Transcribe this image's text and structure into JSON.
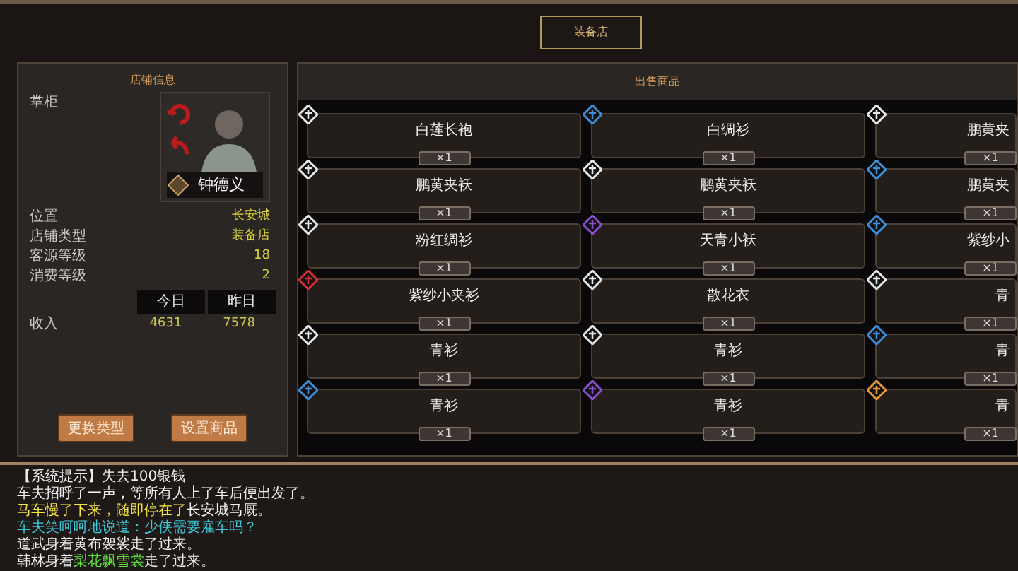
{
  "window": {
    "title": "装备店"
  },
  "shop_info": {
    "title": "店铺信息",
    "keeper_label": "掌柜",
    "keeper_name": "钟德义",
    "fields": [
      {
        "label": "位置",
        "value": "长安城"
      },
      {
        "label": "店铺类型",
        "value": "装备店"
      },
      {
        "label": "客源等级",
        "value": "18"
      },
      {
        "label": "消费等级",
        "value": "2"
      }
    ],
    "income_table": {
      "columns": [
        "今日",
        "昨日"
      ],
      "row_label": "收入",
      "values": [
        "4631",
        "7578"
      ]
    },
    "buttons": [
      "更换类型",
      "设置商品"
    ]
  },
  "goods": {
    "title": "出售商品",
    "items": [
      {
        "name": "白莲长袍",
        "count": "×1",
        "color": "#e8e8e8"
      },
      {
        "name": "白绸衫",
        "count": "×1",
        "color": "#3a8fd8"
      },
      {
        "name": "鹏黄夹",
        "count": "×1",
        "color": "#e8e8e8"
      },
      {
        "name": "鹏黄夹袄",
        "count": "×1",
        "color": "#e8e8e8"
      },
      {
        "name": "鹏黄夹袄",
        "count": "×1",
        "color": "#e8e8e8"
      },
      {
        "name": "鹏黄夹",
        "count": "×1",
        "color": "#3a8fd8"
      },
      {
        "name": "粉红绸衫",
        "count": "×1",
        "color": "#e8e8e8"
      },
      {
        "name": "天青小袄",
        "count": "×1",
        "color": "#8a4fd0"
      },
      {
        "name": "紫纱小",
        "count": "×1",
        "color": "#3a8fd8"
      },
      {
        "name": "紫纱小夹衫",
        "count": "×1",
        "color": "#d83030"
      },
      {
        "name": "散花衣",
        "count": "×1",
        "color": "#e8e8e8"
      },
      {
        "name": "青",
        "count": "×1",
        "color": "#e8e8e8"
      },
      {
        "name": "青衫",
        "count": "×1",
        "color": "#e8e8e8"
      },
      {
        "name": "青衫",
        "count": "×1",
        "color": "#e8e8e8"
      },
      {
        "name": "青",
        "count": "×1",
        "color": "#3a8fd8"
      },
      {
        "name": "青衫",
        "count": "×1",
        "color": "#3a8fd8"
      },
      {
        "name": "青衫",
        "count": "×1",
        "color": "#8a4fd0"
      },
      {
        "name": "青",
        "count": "×1",
        "color": "#e89a30"
      }
    ]
  },
  "log": [
    [
      {
        "text": "【系统提示】失去100银钱",
        "color": "#f0f0f0"
      }
    ],
    [
      {
        "text": "车夫招呼了一声，等所有人上了车后便出发了。",
        "color": "#f0f0f0"
      }
    ],
    [
      {
        "text": "马车慢了下来，随即停在了",
        "color": "#f2e63a"
      },
      {
        "text": "长安城马厩。",
        "color": "#f0f0f0"
      }
    ],
    [
      {
        "text": "车夫笑呵呵地说道：少侠需要雇车吗？",
        "color": "#3ec8d8"
      }
    ],
    [
      {
        "text": "道武身着黄布袈裟走了过来。",
        "color": "#f0f0f0"
      }
    ],
    [
      {
        "text": "韩林身着",
        "color": "#f0f0f0"
      },
      {
        "text": "梨花飘雪裳",
        "color": "#5ee03a"
      },
      {
        "text": "走了过来。",
        "color": "#f0f0f0"
      }
    ]
  ]
}
